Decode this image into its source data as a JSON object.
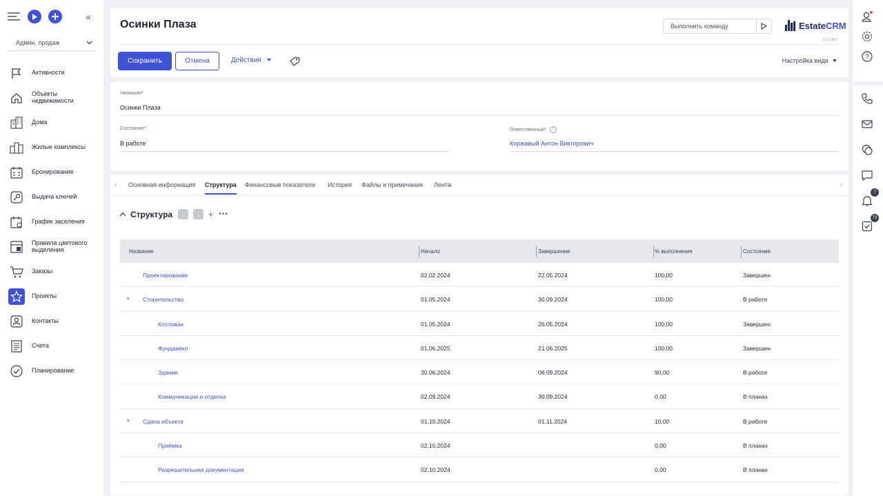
{
  "sidebar": {
    "role": "Админ. продаж",
    "items": [
      {
        "label": "Активности",
        "icon": "flag-icon"
      },
      {
        "label": "Объекты недвижимости",
        "icon": "home-icon"
      },
      {
        "label": "Дома",
        "icon": "building-icon"
      },
      {
        "label": "Жилые комплексы",
        "icon": "complex-icon"
      },
      {
        "label": "Бронирование",
        "icon": "calendar-icon"
      },
      {
        "label": "Выдача ключей",
        "icon": "key-icon"
      },
      {
        "label": "График заселения",
        "icon": "schedule-icon"
      },
      {
        "label": "Правила цветового выделения",
        "icon": "color-rules-icon"
      },
      {
        "label": "Заказы",
        "icon": "cart-icon"
      },
      {
        "label": "Проекты",
        "icon": "star-icon"
      },
      {
        "label": "Контакты",
        "icon": "contact-icon"
      },
      {
        "label": "Счета",
        "icon": "invoice-icon"
      },
      {
        "label": "Планирование",
        "icon": "check-circle-icon"
      }
    ]
  },
  "header": {
    "title": "Осинки Плаза",
    "command_placeholder": "Выполнить команду",
    "logo_main": "Estate",
    "logo_accent": "CRM",
    "version": "1.5.5.901",
    "save_label": "Сохранить",
    "cancel_label": "Отмена",
    "actions_label": "Действия",
    "view_settings_label": "Настройка вида"
  },
  "form": {
    "name_label": "Название",
    "name_value": "Осинки Плаза",
    "state_label": "Состояние",
    "state_value": "В работе",
    "responsible_label": "Ответственный",
    "responsible_value": "Коржавый Антон Викторович"
  },
  "tabs": [
    "Основная информация",
    "Структура",
    "Финансовые показатели",
    "История",
    "Файлы и примечания",
    "Лента"
  ],
  "structure": {
    "title": "Структура",
    "columns": [
      "Название",
      "Начало",
      "Завершение",
      "% выполнения",
      "Состояние"
    ],
    "rows": [
      {
        "name": "Проектирование",
        "start": "02.02.2024",
        "end": "22.05.2024",
        "pct": "100,00",
        "state": "Завершен",
        "level": 0,
        "toggle": false
      },
      {
        "name": "Сторительство",
        "start": "01.05.2024",
        "end": "30.09.2024",
        "pct": "100,00",
        "state": "В работе",
        "level": 0,
        "toggle": true
      },
      {
        "name": "Котлован",
        "start": "01.05.2024",
        "end": "26.05.2024",
        "pct": "100,00",
        "state": "Завершен",
        "level": 1,
        "toggle": false
      },
      {
        "name": "Фундамент",
        "start": "01.06.2025",
        "end": "21.06.2025",
        "pct": "100,00",
        "state": "Завершен",
        "level": 1,
        "toggle": false
      },
      {
        "name": "Здание",
        "start": "30.06.2024",
        "end": "08.09.2024",
        "pct": "90,00",
        "state": "В работе",
        "level": 1,
        "toggle": false
      },
      {
        "name": "Коммуникации и отделка",
        "start": "02.09.2024",
        "end": "30.09.2024",
        "pct": "0,00",
        "state": "В планах",
        "level": 1,
        "toggle": false
      },
      {
        "name": "Сдача объекта",
        "start": "01.10.2024",
        "end": "01.11.2024",
        "pct": "10,00",
        "state": "В работе",
        "level": 0,
        "toggle": true
      },
      {
        "name": "Приёмка",
        "start": "02.10.2024",
        "end": "",
        "pct": "0,00",
        "state": "В планах",
        "level": 1,
        "toggle": false
      },
      {
        "name": "Разрешительная документация",
        "start": "02.10.2024",
        "end": "",
        "pct": "0,00",
        "state": "В планах",
        "level": 1,
        "toggle": false
      }
    ]
  },
  "right_panel": {
    "notifications_count": "7",
    "tasks_count": "73"
  },
  "colors": {
    "accent": "#3f51d4",
    "background": "#eef0f5"
  }
}
